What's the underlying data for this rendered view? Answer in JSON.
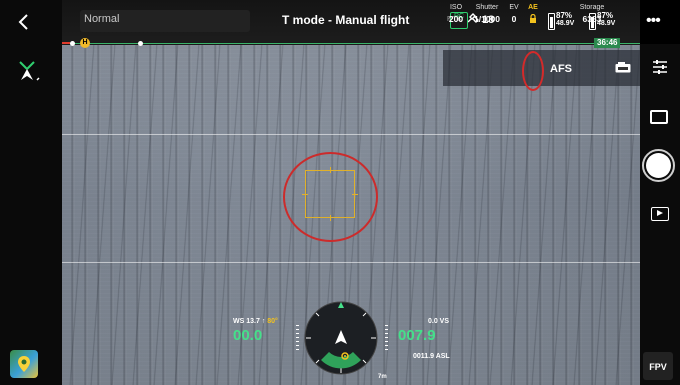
{
  "top_bar": {
    "mode_label": "Normal",
    "title": "T mode - Manual flight",
    "rtk_label": "RTK",
    "satellite_count": "18",
    "rc_label": "RC",
    "battery_1": {
      "percent": "87%",
      "voltage": "48.9V"
    },
    "battery_2": {
      "percent": "87%",
      "voltage": "48.9V"
    },
    "more_label": "•••"
  },
  "timeline": {
    "home_label": "H",
    "flight_time": "36:46"
  },
  "camera": {
    "iso": {
      "label": "ISO",
      "value": "200"
    },
    "shutter": {
      "label": "Shutter",
      "value": "1/1000"
    },
    "ev": {
      "label": "EV",
      "value": "0"
    },
    "ae": {
      "label": "AE"
    },
    "focus_mode": "AFS",
    "storage": {
      "label": "Storage",
      "value": "6383"
    }
  },
  "right_bar": {
    "fpv_label": "FPV"
  },
  "telemetry": {
    "wind_speed": "WS 13.7",
    "wind_heading": "80°",
    "speed": "00.0",
    "vertical_speed": "0.0 VS",
    "altitude": "007.9",
    "asl": "0011.9 ASL",
    "distance": "7m"
  },
  "colors": {
    "accent_green": "#45e08a",
    "warning_yellow": "#f3c21d",
    "annotation_red": "#cc2b2b"
  }
}
